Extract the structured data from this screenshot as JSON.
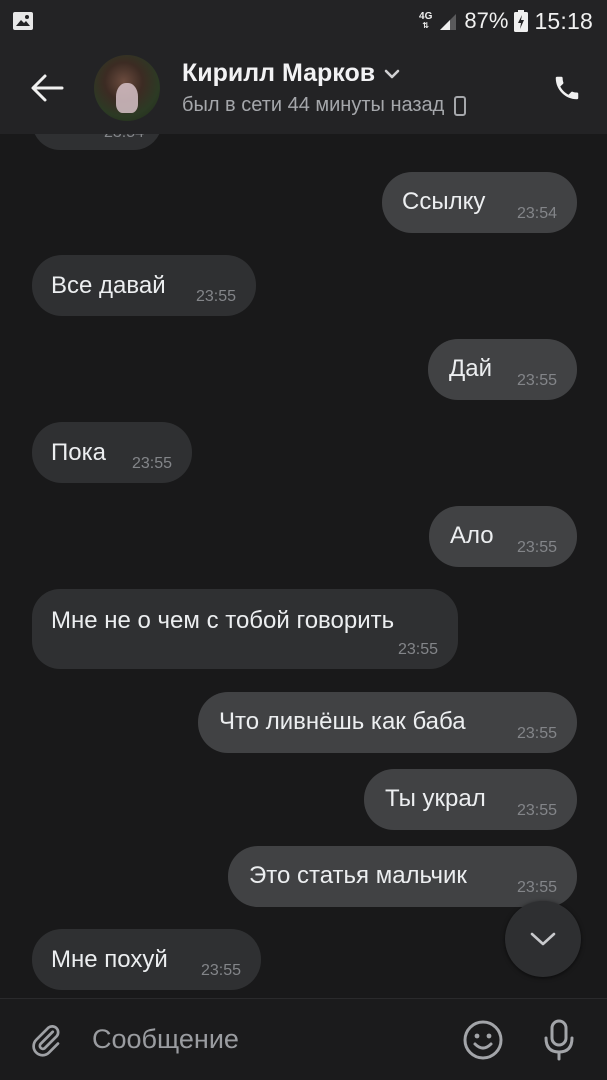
{
  "status_bar": {
    "network_type": "4G",
    "battery_percent": "87%",
    "time": "15:18"
  },
  "header": {
    "contact_name": "Кирилл Марков",
    "last_seen": "был в сети 44 минуты назад"
  },
  "messages": [
    {
      "text": "",
      "time": "23:54",
      "direction": "in"
    },
    {
      "text": "Ссылку",
      "time": "23:54",
      "direction": "out"
    },
    {
      "text": "Все давай",
      "time": "23:55",
      "direction": "in"
    },
    {
      "text": "Дай",
      "time": "23:55",
      "direction": "out"
    },
    {
      "text": "Пока",
      "time": "23:55",
      "direction": "in"
    },
    {
      "text": "Ало",
      "time": "23:55",
      "direction": "out"
    },
    {
      "text": "Мне не о чем с тобой говорить",
      "time": "23:55",
      "direction": "in"
    },
    {
      "text": "Что ливнёшь как баба",
      "time": "23:55",
      "direction": "out"
    },
    {
      "text": "Ты украл",
      "time": "23:55",
      "direction": "out"
    },
    {
      "text": "Это статья мальчик",
      "time": "23:55",
      "direction": "out"
    },
    {
      "text": "Мне похуй",
      "time": "23:55",
      "direction": "in"
    }
  ],
  "composer": {
    "placeholder": "Сообщение"
  },
  "colors": {
    "background": "#19191a",
    "bar": "#232325",
    "bubble_in": "#2f3032",
    "bubble_out": "#414244"
  },
  "icons": {
    "back": "arrow-left-icon",
    "dropdown": "chevron-down-icon",
    "device": "phone-device-icon",
    "call": "phone-icon",
    "scroll": "chevron-down-icon",
    "attach": "paperclip-icon",
    "emoji": "smile-icon",
    "mic": "microphone-icon"
  }
}
